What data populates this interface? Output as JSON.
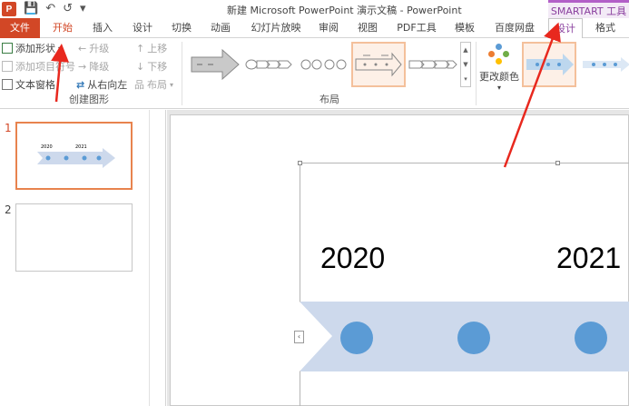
{
  "app": {
    "logo_letter": "P",
    "title": "新建 Microsoft PowerPoint 演示文稿 - PowerPoint",
    "contextual_group": "SMARTART 工具"
  },
  "qat": {
    "save": "💾",
    "undo": "↶",
    "redo": "↺",
    "customize": "▾"
  },
  "tabs": [
    {
      "label": "文件"
    },
    {
      "label": "开始"
    },
    {
      "label": "插入"
    },
    {
      "label": "设计"
    },
    {
      "label": "切换"
    },
    {
      "label": "动画"
    },
    {
      "label": "幻灯片放映"
    },
    {
      "label": "审阅"
    },
    {
      "label": "视图"
    },
    {
      "label": "PDF工具"
    },
    {
      "label": "模板"
    },
    {
      "label": "百度网盘"
    },
    {
      "label": "设计"
    },
    {
      "label": "格式"
    }
  ],
  "ribbon": {
    "create_graphic": {
      "add_shape": "添加形状",
      "add_bullet": "添加项目符号",
      "text_pane": "文本窗格",
      "promote": "升级",
      "demote": "降级",
      "right_to_left": "从右向左",
      "move_up": "上移",
      "move_down": "下移",
      "layout": "布局",
      "group_label": "创建图形"
    },
    "layouts": {
      "group_label": "布局"
    },
    "change_colors": "更改颜色"
  },
  "slides": [
    {
      "number": "1"
    },
    {
      "number": "2"
    }
  ],
  "thumb_years": [
    "2020",
    "2021"
  ],
  "slide": {
    "years": [
      "2020",
      "2021"
    ]
  },
  "colors": {
    "accent_file": "#d24726",
    "smartart_accent": "#8a3f9e",
    "circle": "#5b9bd5",
    "band": "#cdd9ec",
    "annotation": "#e8281e"
  }
}
